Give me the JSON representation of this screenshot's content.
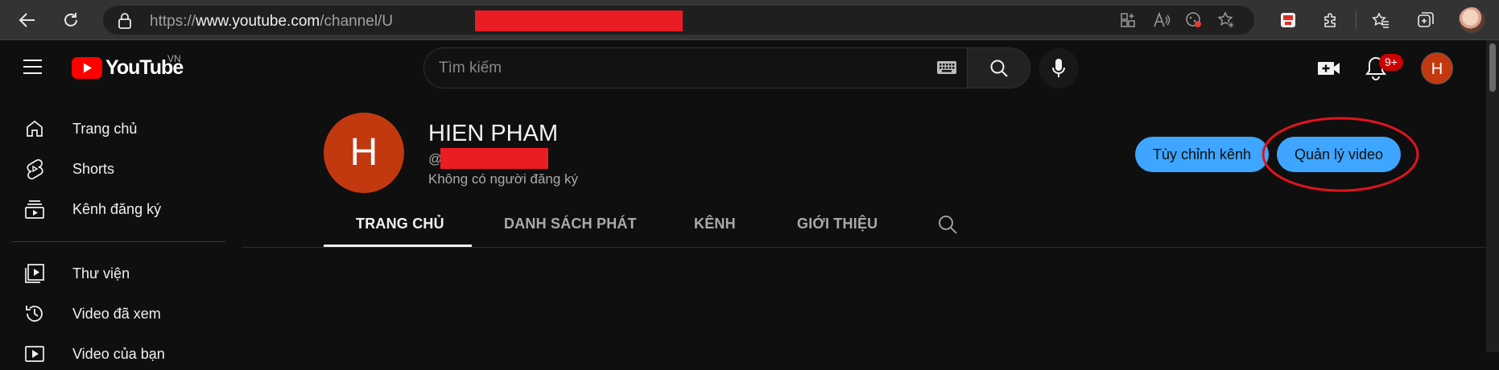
{
  "browser": {
    "url_prefix": "https://",
    "url_host": "www.youtube.com",
    "url_path": "/channel/U"
  },
  "youtube": {
    "logo_text": "YouTube",
    "country_code": "VN",
    "search_placeholder": "Tìm kiếm",
    "notification_badge": "9+",
    "avatar_initial": "H",
    "brand_red": "#ff0000",
    "accent_blue": "#3ea6ff"
  },
  "sidebar": {
    "items": [
      {
        "label": "Trang chủ",
        "icon": "home-icon"
      },
      {
        "label": "Shorts",
        "icon": "shorts-icon"
      },
      {
        "label": "Kênh đăng ký",
        "icon": "subscriptions-icon"
      },
      {
        "label": "Thư viện",
        "icon": "library-icon"
      },
      {
        "label": "Video đã xem",
        "icon": "history-icon"
      },
      {
        "label": "Video của bạn",
        "icon": "your-videos-icon"
      }
    ]
  },
  "channel": {
    "avatar_initial": "H",
    "name": "HIEN PHAM",
    "handle_prefix": "@",
    "subscribers": "Không có người đăng ký",
    "customize_label": "Tùy chỉnh kênh",
    "manage_label": "Quản lý video",
    "tabs": [
      "TRANG CHỦ",
      "DANH SÁCH PHÁT",
      "KÊNH",
      "GIỚI THIỆU"
    ],
    "active_tab": "TRANG CHỦ"
  }
}
